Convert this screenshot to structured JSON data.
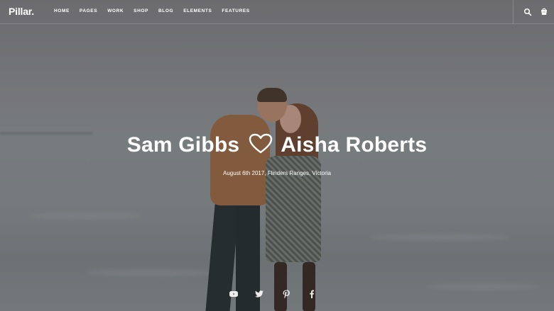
{
  "brand": {
    "logo": "Pillar."
  },
  "nav": {
    "items": [
      "HOME",
      "PAGES",
      "WORK",
      "SHOP",
      "BLOG",
      "ELEMENTS",
      "FEATURES"
    ]
  },
  "header_icons": [
    "search-icon",
    "cart-icon"
  ],
  "hero": {
    "name_left": "Sam Gibbs",
    "name_right": "Aisha Roberts",
    "subtitle": "August 6th 2017, Flinders Ranges, Victoria"
  },
  "social": [
    "youtube-icon",
    "twitter-icon",
    "pinterest-icon",
    "facebook-icon"
  ],
  "colors": {
    "text": "#ffffff",
    "overlay": "#1a1a1f"
  }
}
